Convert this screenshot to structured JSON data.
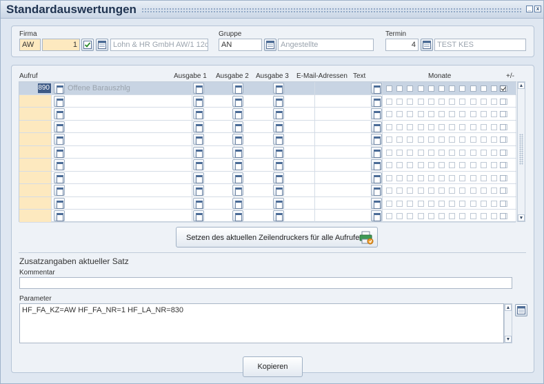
{
  "window": {
    "title": "Standardauswertungen",
    "min_label": "_",
    "close_label": "x"
  },
  "header": {
    "firma": {
      "label": "Firma",
      "code": "AW",
      "number": "1",
      "name": "Lohn & HR GmbH AW/1 12c"
    },
    "gruppe": {
      "label": "Gruppe",
      "code": "AN",
      "name": "Angestellte"
    },
    "termin": {
      "label": "Termin",
      "number": "4",
      "name": "TEST KES"
    }
  },
  "grid": {
    "columns": {
      "aufruf": "Aufruf",
      "ausgabe1": "Ausgabe 1",
      "ausgabe2": "Ausgabe 2",
      "ausgabe3": "Ausgabe 3",
      "email": "E-Mail-Adressen",
      "text": "Text",
      "monate": "Monate",
      "plusminus": "+/-"
    },
    "rows": [
      {
        "number": "890",
        "text": "Offene Barauszhlg",
        "selected": true
      },
      {
        "number": "",
        "text": ""
      },
      {
        "number": "",
        "text": ""
      },
      {
        "number": "",
        "text": ""
      },
      {
        "number": "",
        "text": ""
      },
      {
        "number": "",
        "text": ""
      },
      {
        "number": "",
        "text": ""
      },
      {
        "number": "",
        "text": ""
      },
      {
        "number": "",
        "text": ""
      },
      {
        "number": "",
        "text": ""
      },
      {
        "number": "",
        "text": ""
      }
    ]
  },
  "actions": {
    "set_printer_label": "Setzen des aktuellen Zeilendruckers für alle Aufrufe",
    "copy_label": "Kopieren"
  },
  "details": {
    "title": "Zusatzangaben aktueller Satz",
    "kommentar_label": "Kommentar",
    "kommentar_value": "",
    "parameter_label": "Parameter",
    "parameter_value": "HF_FA_KZ=AW HF_FA_NR=1 HF_LA_NR=830"
  },
  "colors": {
    "required": "#fde9bf",
    "selected_row": "#c8d4e3",
    "title": "#1f3350"
  }
}
